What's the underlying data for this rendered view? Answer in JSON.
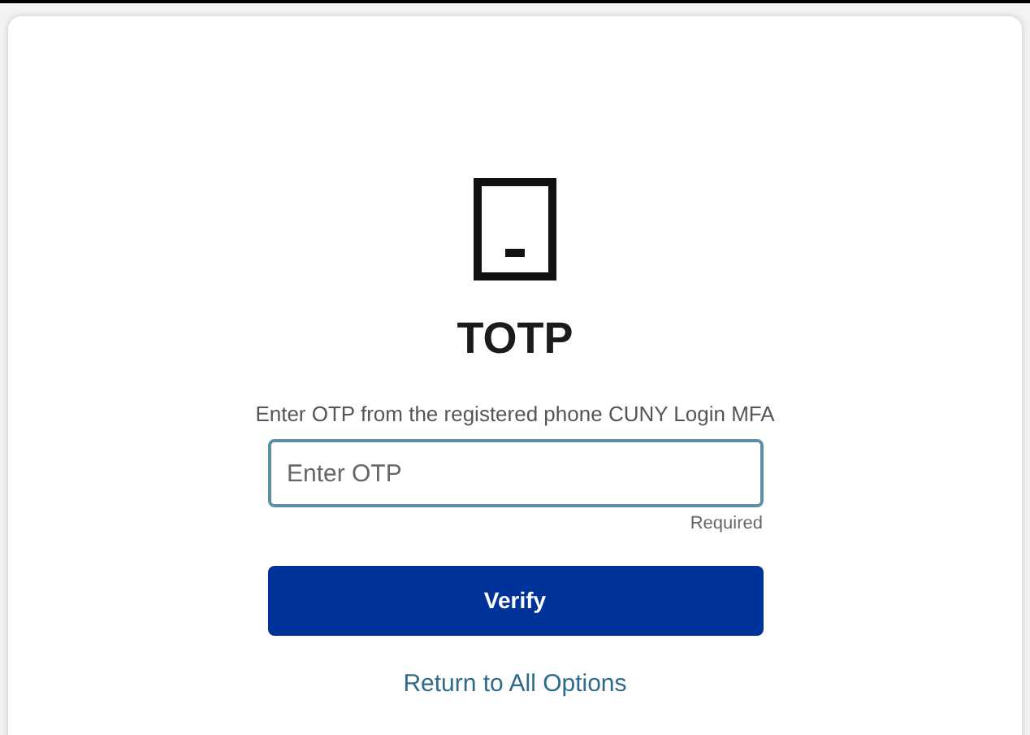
{
  "title": "TOTP",
  "instruction": "Enter OTP from the registered phone CUNY Login MFA",
  "otp_field": {
    "placeholder": "Enter OTP"
  },
  "required_note": "Required",
  "verify_button": "Verify",
  "return_link": "Return to All Options"
}
